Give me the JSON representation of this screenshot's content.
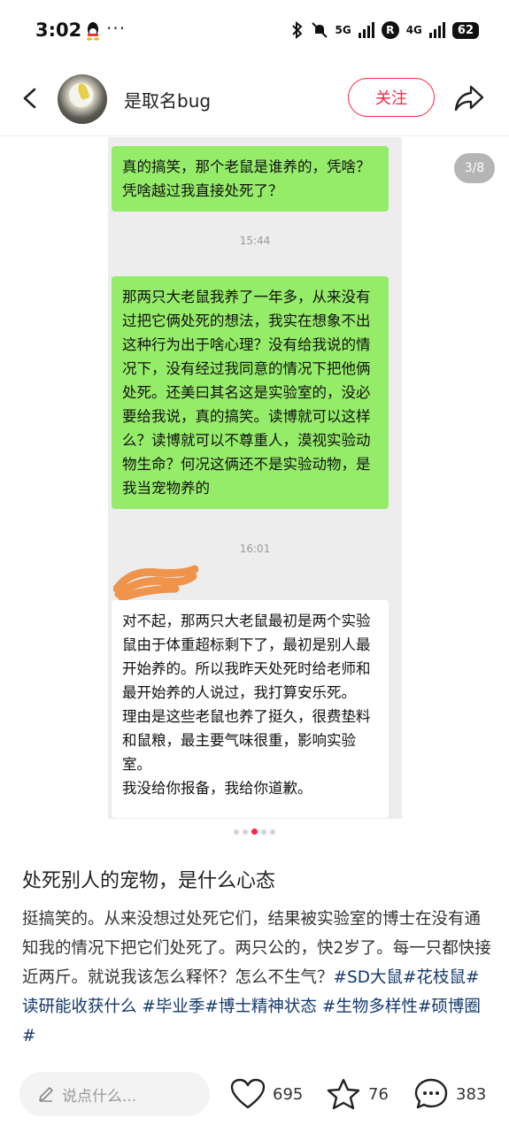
{
  "status_bar": {
    "time": "3:02",
    "more": "···",
    "net_5g": "5G",
    "net_4g": "4G",
    "r_badge": "R",
    "battery": "62"
  },
  "header": {
    "username": "是取名bug",
    "follow_label": "关注"
  },
  "image": {
    "page_indicator": "3/8",
    "dot_count": 5,
    "active_dot": 3
  },
  "chat": {
    "messages": [
      {
        "type": "sent",
        "text": "真的搞笑，那个老鼠是谁养的，凭啥？凭啥越过我直接处死了？"
      },
      {
        "type": "time",
        "text": "15:44"
      },
      {
        "type": "sent",
        "text": "那两只大老鼠我养了一年多，从来没有过把它俩处死的想法，我实在想象不出这种行为出于啥心理？没有给我说的情况下，没有经过我同意的情况下把他俩处死。还美曰其名这是实验室的，没必要给我说，真的搞笑。读博就可以这样么？读博就可以不尊重人，漠视实验动物生命？何况这俩还不是实验动物，是我当宠物养的"
      },
      {
        "type": "time",
        "text": "16:01"
      },
      {
        "type": "received",
        "text": "对不起，那两只大老鼠最初是两个实验鼠由于体重超标剩下了，最初是别人最开始养的。所以我昨天处死时给老师和最开始养的人说过，我打算安乐死。\n理由是这些老鼠也养了挺久，很费垫料和鼠粮，最主要气味很重，影响实验室。\n我没给你报备，我给你道歉。"
      }
    ]
  },
  "post": {
    "title": "处死别人的宠物，是什么心态",
    "body": "挺搞笑的。从来没想过处死它们，结果被实验室的博士在没有通知我的情况下把它们处死了。两只公的，快2岁了。每一只都快接近两斤。就说我该怎么释怀？怎么不生气？",
    "tags": [
      "#SD大鼠",
      "#花枝鼠",
      "#读研能收获什么",
      "#毕业季",
      "#博士精神状态",
      "#生物多样性",
      "#硕博圈#"
    ]
  },
  "bottom_bar": {
    "comment_placeholder": "说点什么...",
    "likes": "695",
    "favorites": "76",
    "comments": "383"
  }
}
